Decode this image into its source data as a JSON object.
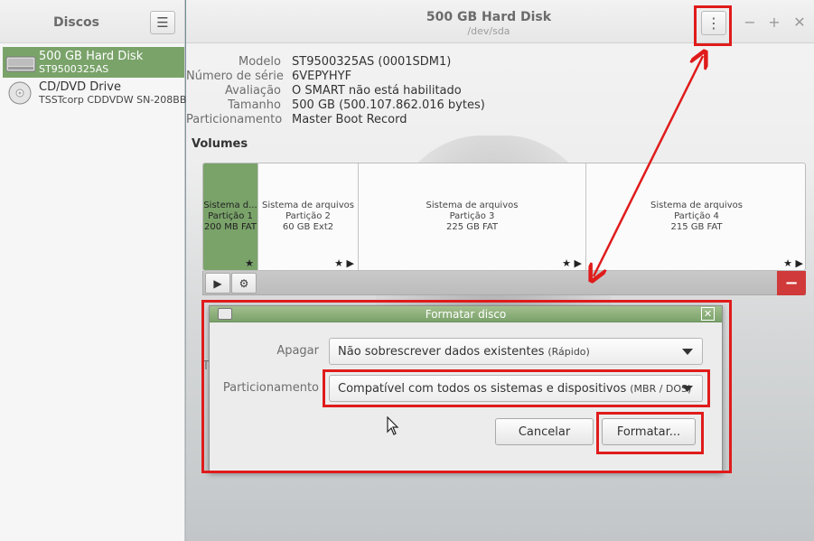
{
  "sidebar": {
    "title": "Discos",
    "menu_icon": "hamburger-menu-icon",
    "disks": [
      {
        "name": "500 GB Hard Disk",
        "sub": "ST9500325AS",
        "icon": "hard-disk-icon",
        "selected": true
      },
      {
        "name": "CD/DVD Drive",
        "sub": "TSSTcorp CDDVDW SN-208BB",
        "icon": "optical-disc-icon",
        "selected": false
      }
    ]
  },
  "header": {
    "title": "500 GB Hard Disk",
    "subtitle": "/dev/sda",
    "menu_icon": "vertical-dots-icon",
    "minimize": "−",
    "maximize": "+",
    "close": "✕"
  },
  "details": [
    {
      "label": "Modelo",
      "value": "ST9500325AS (0001SDM1)"
    },
    {
      "label": "Número de série",
      "value": "6VEPYHYF"
    },
    {
      "label": "Avaliação",
      "value": "O SMART não está habilitado"
    },
    {
      "label": "Tamanho",
      "value": "500 GB (500.107.862.016 bytes)"
    },
    {
      "label": "Particionamento",
      "value": "Master Boot Record"
    }
  ],
  "volumes": {
    "title": "Volumes",
    "partitions": [
      {
        "line1": "Sistema d...",
        "line2": "Partição 1",
        "line3": "200 MB FAT",
        "icons": "★",
        "selected": true
      },
      {
        "line1": "Sistema de arquivos",
        "line2": "Partição 2",
        "line3": "60 GB Ext2",
        "icons": "★ ▶",
        "selected": false
      },
      {
        "line1": "Sistema de arquivos",
        "line2": "Partição 3",
        "line3": "225 GB FAT",
        "icons": "★ ▶",
        "selected": false
      },
      {
        "line1": "Sistema de arquivos",
        "line2": "Partição 4",
        "line3": "215 GB FAT",
        "icons": "★ ▶",
        "selected": false
      }
    ],
    "toolbar": {
      "play": "▶",
      "gear": "⚙",
      "minus": "−"
    },
    "stray_text": "T"
  },
  "dialog": {
    "title": "Formatar disco",
    "close": "✕",
    "erase_label": "Apagar",
    "erase_value": "Não sobrescrever dados existentes",
    "erase_hint": "(Rápido)",
    "partitioning_label": "Particionamento",
    "partitioning_value": "Compatível com todos os sistemas e dispositivos",
    "partitioning_hint": "(MBR / DOS)",
    "cancel": "Cancelar",
    "format": "Formatar..."
  },
  "colors": {
    "accent_green": "#7aa36a",
    "annotation_red": "#e01b1b",
    "danger_red": "#d13a3a"
  }
}
